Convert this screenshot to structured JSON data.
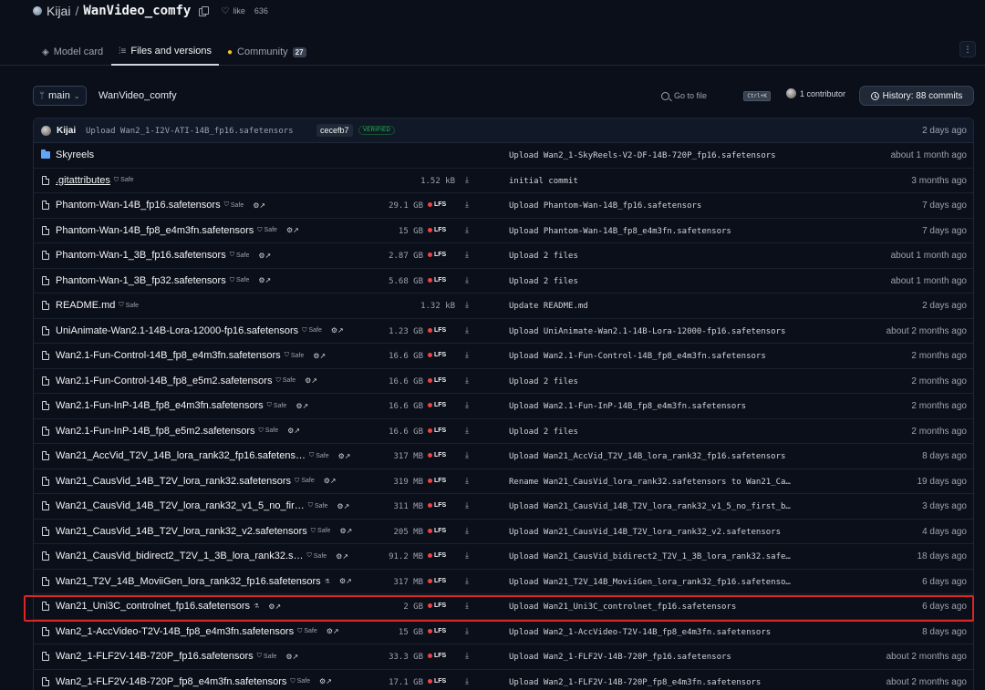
{
  "repo": {
    "owner": "Kijai",
    "name": "WanVideo_comfy",
    "like_label": "like",
    "like_count": "636"
  },
  "tabs": [
    {
      "label": "Model card",
      "icon": "model-card-icon"
    },
    {
      "label": "Files and versions",
      "icon": "files-icon"
    },
    {
      "label": "Community",
      "icon": "community-icon",
      "badge": "27"
    }
  ],
  "toolbar": {
    "branch": "main",
    "breadcrumb": "WanVideo_comfy",
    "goto_placeholder": "Go to file",
    "goto_shortcut": "Ctrl+K",
    "contributors": "1 contributor",
    "history": "History: 88 commits"
  },
  "last_commit": {
    "author": "Kijai",
    "message": "Upload Wan2_1-I2V-ATI-14B_fp16.safetensors",
    "sha": "cecefb7",
    "verified": "VERIFIED",
    "date": "2 days ago"
  },
  "files": [
    {
      "type": "dir",
      "name": "Skyreels",
      "commit": "Upload Wan2_1-SkyReels-V2-DF-14B-720P_fp16.safetensors",
      "date": "about 1 month ago"
    },
    {
      "type": "file",
      "name": ".gitattributes",
      "safe": "Safe",
      "size": "1.52 kB",
      "commit": "initial commit",
      "date": "3 months ago",
      "underline": true
    },
    {
      "type": "file",
      "name": "Phantom-Wan-14B_fp16.safetensors",
      "safe": "Safe",
      "size": "29.1 GB",
      "lfs": "LFS",
      "commit": "Upload Phantom-Wan-14B_fp16.safetensors",
      "date": "7 days ago"
    },
    {
      "type": "file",
      "name": "Phantom-Wan-14B_fp8_e4m3fn.safetensors",
      "safe": "Safe",
      "size": "15 GB",
      "lfs": "LFS",
      "commit": "Upload Phantom-Wan-14B_fp8_e4m3fn.safetensors",
      "date": "7 days ago"
    },
    {
      "type": "file",
      "name": "Phantom-Wan-1_3B_fp16.safetensors",
      "safe": "Safe",
      "size": "2.87 GB",
      "lfs": "LFS",
      "commit": "Upload 2 files",
      "date": "about 1 month ago"
    },
    {
      "type": "file",
      "name": "Phantom-Wan-1_3B_fp32.safetensors",
      "safe": "Safe",
      "size": "5.68 GB",
      "lfs": "LFS",
      "commit": "Upload 2 files",
      "date": "about 1 month ago"
    },
    {
      "type": "file",
      "name": "README.md",
      "safe": "Safe",
      "size": "1.32 kB",
      "commit": "Update README.md",
      "date": "2 days ago"
    },
    {
      "type": "file",
      "name": "UniAnimate-Wan2.1-14B-Lora-12000-fp16.safetensors",
      "safe": "Safe",
      "size": "1.23 GB",
      "lfs": "LFS",
      "commit": "Upload UniAnimate-Wan2.1-14B-Lora-12000-fp16.safetensors",
      "date": "about 2 months ago"
    },
    {
      "type": "file",
      "name": "Wan2.1-Fun-Control-14B_fp8_e4m3fn.safetensors",
      "safe": "Safe",
      "size": "16.6 GB",
      "lfs": "LFS",
      "commit": "Upload Wan2.1-Fun-Control-14B_fp8_e4m3fn.safetensors",
      "date": "2 months ago"
    },
    {
      "type": "file",
      "name": "Wan2.1-Fun-Control-14B_fp8_e5m2.safetensors",
      "safe": "Safe",
      "size": "16.6 GB",
      "lfs": "LFS",
      "commit": "Upload 2 files",
      "date": "2 months ago"
    },
    {
      "type": "file",
      "name": "Wan2.1-Fun-InP-14B_fp8_e4m3fn.safetensors",
      "safe": "Safe",
      "size": "16.6 GB",
      "lfs": "LFS",
      "commit": "Upload Wan2.1-Fun-InP-14B_fp8_e4m3fn.safetensors",
      "date": "2 months ago"
    },
    {
      "type": "file",
      "name": "Wan2.1-Fun-InP-14B_fp8_e5m2.safetensors",
      "safe": "Safe",
      "size": "16.6 GB",
      "lfs": "LFS",
      "commit": "Upload 2 files",
      "date": "2 months ago"
    },
    {
      "type": "file",
      "name": "Wan21_AccVid_T2V_14B_lora_rank32_fp16.safetens…",
      "safe": "Safe",
      "size": "317 MB",
      "lfs": "LFS",
      "commit": "Upload Wan21_AccVid_T2V_14B_lora_rank32_fp16.safetensors",
      "date": "8 days ago"
    },
    {
      "type": "file",
      "name": "Wan21_CausVid_14B_T2V_lora_rank32.safetensors",
      "safe": "Safe",
      "size": "319 MB",
      "lfs": "LFS",
      "commit": "Rename Wan21_CausVid_lora_rank32.safetensors to Wan21_Ca…",
      "date": "19 days ago"
    },
    {
      "type": "file",
      "name": "Wan21_CausVid_14B_T2V_lora_rank32_v1_5_no_fir…",
      "safe": "Safe",
      "size": "311 MB",
      "lfs": "LFS",
      "commit": "Upload Wan21_CausVid_14B_T2V_lora_rank32_v1_5_no_first_b…",
      "date": "3 days ago"
    },
    {
      "type": "file",
      "name": "Wan21_CausVid_14B_T2V_lora_rank32_v2.safetensors",
      "safe": "Safe",
      "size": "205 MB",
      "lfs": "LFS",
      "commit": "Upload Wan21_CausVid_14B_T2V_lora_rank32_v2.safetensors",
      "date": "4 days ago"
    },
    {
      "type": "file",
      "name": "Wan21_CausVid_bidirect2_T2V_1_3B_lora_rank32.s…",
      "safe": "Safe",
      "size": "91.2 MB",
      "lfs": "LFS",
      "commit": "Upload Wan21_CausVid_bidirect2_T2V_1_3B_lora_rank32.safe…",
      "date": "18 days ago"
    },
    {
      "type": "file",
      "name": "Wan21_T2V_14B_MoviiGen_lora_rank32_fp16.safetensors",
      "pickle": true,
      "size": "317 MB",
      "lfs": "LFS",
      "commit": "Upload Wan21_T2V_14B_MoviiGen_lora_rank32_fp16.safetenso…",
      "date": "6 days ago"
    },
    {
      "type": "file",
      "name": "Wan21_Uni3C_controlnet_fp16.safetensors",
      "pickle": true,
      "size": "2 GB",
      "lfs": "LFS",
      "commit": "Upload Wan21_Uni3C_controlnet_fp16.safetensors",
      "date": "6 days ago"
    },
    {
      "type": "file",
      "name": "Wan2_1-AccVideo-T2V-14B_fp8_e4m3fn.safetensors",
      "safe": "Safe",
      "size": "15 GB",
      "lfs": "LFS",
      "commit": "Upload Wan2_1-AccVideo-T2V-14B_fp8_e4m3fn.safetensors",
      "date": "8 days ago"
    },
    {
      "type": "file",
      "name": "Wan2_1-FLF2V-14B-720P_fp16.safetensors",
      "safe": "Safe",
      "size": "33.3 GB",
      "lfs": "LFS",
      "commit": "Upload Wan2_1-FLF2V-14B-720P_fp16.safetensors",
      "date": "about 2 months ago"
    },
    {
      "type": "file",
      "name": "Wan2_1-FLF2V-14B-720P_fp8_e4m3fn.safetensors",
      "safe": "Safe",
      "size": "17.1 GB",
      "lfs": "LFS",
      "commit": "Upload Wan2_1-FLF2V-14B-720P_fp8_e4m3fn.safetensors",
      "date": "about 2 months ago"
    }
  ],
  "colors": {
    "accent_lfs": "#ef4444",
    "folder": "#60a5fa",
    "highlight": "#dc2626",
    "verified": "#22c55e"
  }
}
